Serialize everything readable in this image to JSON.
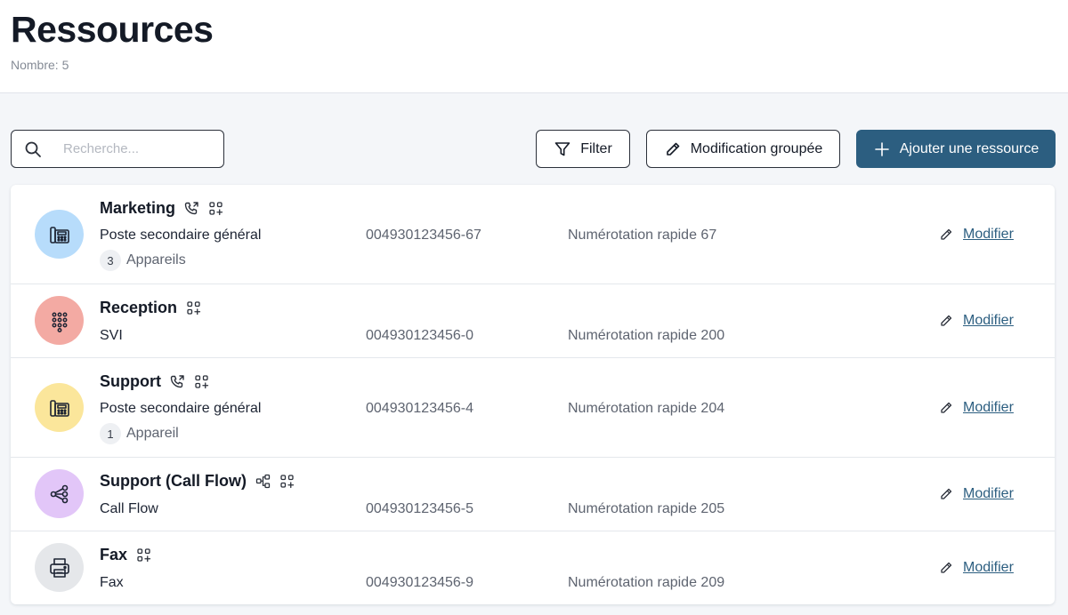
{
  "header": {
    "title": "Ressources",
    "count_text": "Nombre: 5"
  },
  "toolbar": {
    "search_placeholder": "Recherche...",
    "filter_label": "Filter",
    "bulk_edit_label": "Modification groupée",
    "add_label": "Ajouter une ressource"
  },
  "colors": {
    "primary": "#2c5e80",
    "avatar_blue": "#b7dcfb",
    "avatar_red": "#f3aaa3",
    "avatar_yellow": "#fbe69b",
    "avatar_purple": "#e2c6f8",
    "avatar_grey": "#e5e7ea"
  },
  "resources": [
    {
      "name": "Marketing",
      "type": "Poste secondaire général",
      "number": "004930123456-67",
      "speed_dial": "Numérotation rapide 67",
      "device_count": "3",
      "device_label": "Appareils",
      "edit_label": "Modifier",
      "icon": "desk-phone-icon",
      "badges": [
        "phone-forward-icon",
        "apps-add-icon"
      ]
    },
    {
      "name": "Reception",
      "type": "SVI",
      "number": "004930123456-0",
      "speed_dial": "Numérotation rapide 200",
      "edit_label": "Modifier",
      "icon": "dialpad-icon",
      "badges": [
        "apps-add-icon"
      ]
    },
    {
      "name": "Support",
      "type": "Poste secondaire général",
      "number": "004930123456-4",
      "speed_dial": "Numérotation rapide 204",
      "device_count": "1",
      "device_label": "Appareil",
      "edit_label": "Modifier",
      "icon": "desk-phone-icon",
      "badges": [
        "phone-forward-icon",
        "apps-add-icon"
      ]
    },
    {
      "name": "Support (Call Flow)",
      "type": "Call Flow",
      "number": "004930123456-5",
      "speed_dial": "Numérotation rapide 205",
      "edit_label": "Modifier",
      "icon": "call-flow-icon",
      "badges": [
        "flow-chart-icon",
        "apps-add-icon"
      ]
    },
    {
      "name": "Fax",
      "type": "Fax",
      "number": "004930123456-9",
      "speed_dial": "Numérotation rapide 209",
      "edit_label": "Modifier",
      "icon": "printer-icon",
      "badges": [
        "apps-add-icon"
      ]
    }
  ]
}
